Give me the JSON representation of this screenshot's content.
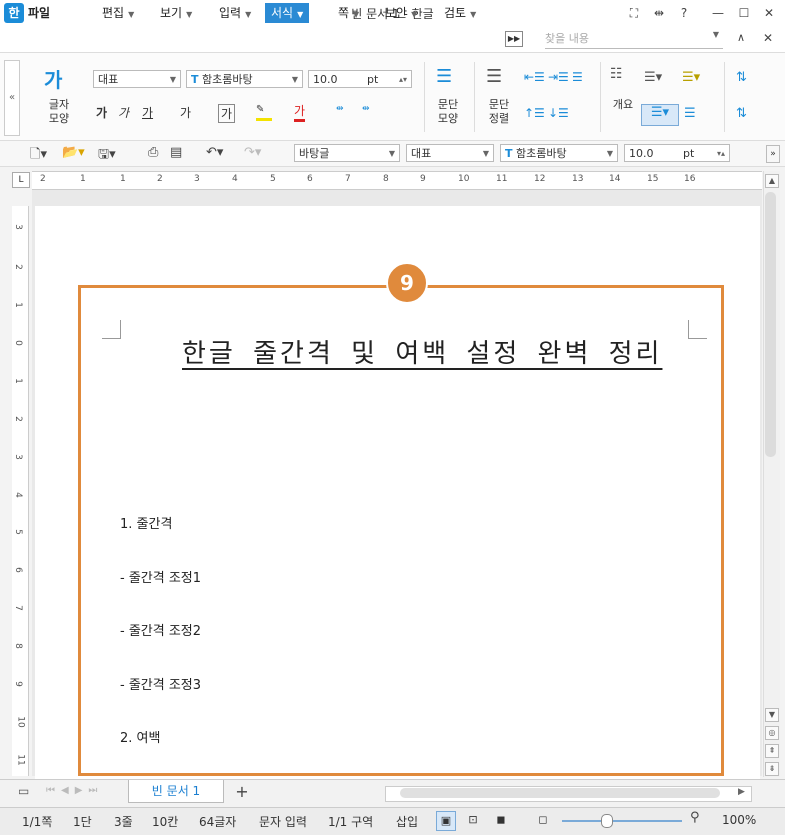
{
  "window": {
    "title": "빈 문서 1 - 한글",
    "app_icon": "한"
  },
  "titlebar_icons": [
    "restore-fit-icon",
    "resize-icon",
    "help-icon",
    "minimize-icon",
    "maximize-icon",
    "close-icon"
  ],
  "titlebar_glyphs": {
    "fit": "⛶",
    "resize": "⇹",
    "help": "?",
    "min": "—",
    "max": "☐",
    "close": "✕"
  },
  "menu": {
    "file": "파일",
    "items": [
      "편집",
      "보기",
      "입력",
      "서식",
      "쪽",
      "보안",
      "검토"
    ],
    "active": "서식",
    "search_placeholder": "찾을 내용"
  },
  "ribbon": {
    "char_shape_label_1": "글자",
    "char_shape_label_2": "모양",
    "style_value": "대표",
    "font_value": "함초롬바탕",
    "size_value": "10.0",
    "size_unit": "pt",
    "para_shape_label_1": "문단",
    "para_shape_label_2": "모양",
    "para_align_label_1": "문단",
    "para_align_label_2": "정렬",
    "outline_label": "개요",
    "char_buttons": [
      "가",
      "가",
      "가",
      "가",
      "가"
    ]
  },
  "quickbar": {
    "style_value": "바탕글",
    "style2_value": "대표",
    "font_value": "함초롬바탕",
    "size_value": "10.0",
    "size_unit": "pt"
  },
  "ruler": {
    "h_ticks": [
      "2",
      "1",
      "1",
      "2",
      "3",
      "4",
      "5",
      "6",
      "7",
      "8",
      "9",
      "10",
      "11",
      "12",
      "13",
      "14",
      "15",
      "16"
    ],
    "v_ticks": [
      "3",
      "2",
      "1",
      "0",
      "1",
      "2",
      "3",
      "4",
      "5",
      "6",
      "7",
      "8",
      "9",
      "10",
      "11"
    ]
  },
  "document": {
    "badge": "9",
    "title": "한글 줄간격 및 여백 설정 완벽 정리",
    "lines": [
      "1. 줄간격",
      "- 줄간격 조정1",
      "- 줄간격 조정2",
      "- 줄간격 조정3",
      "2. 여백"
    ]
  },
  "tabs": {
    "doc_tab": "빈 문서 1",
    "add": "+"
  },
  "status": {
    "page": "1/1쪽",
    "column": "1단",
    "line": "3줄",
    "col": "10칸",
    "chars": "64글자",
    "mode": "문자 입력",
    "section": "1/1 구역",
    "insert": "삽입",
    "zoom": "100%"
  },
  "colors": {
    "accent": "#2a8ad4",
    "frame": "#e08a3c"
  }
}
